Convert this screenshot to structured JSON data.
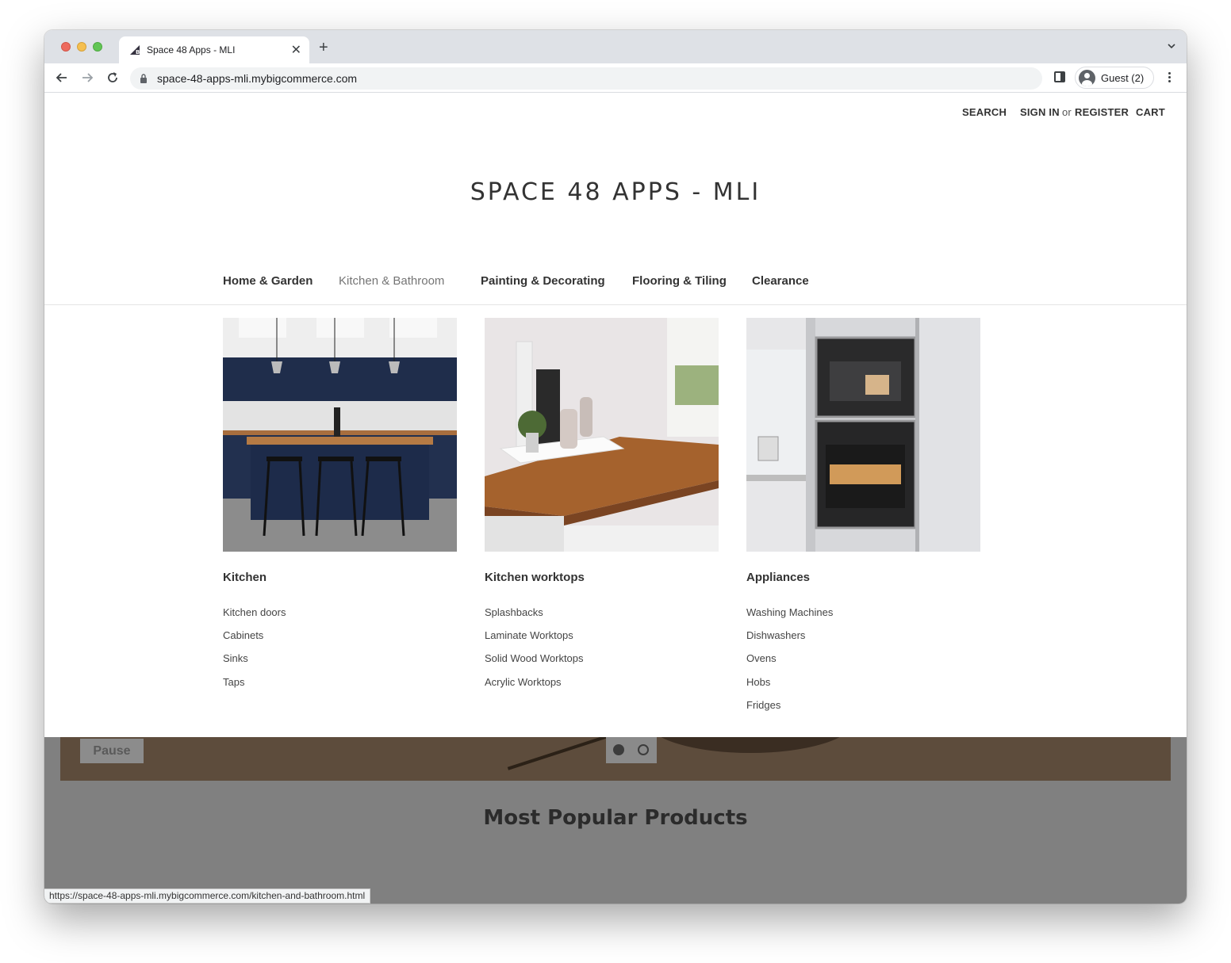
{
  "browser": {
    "tab_title": "Space 48 Apps - MLI",
    "new_tab": "+",
    "close_tab": "✕",
    "url": "space-48-apps-mli.mybigcommerce.com",
    "profile_label": "Guest (2)",
    "status_url": "https://space-48-apps-mli.mybigcommerce.com/kitchen-and-bathroom.html"
  },
  "header": {
    "search": "SEARCH",
    "sign_in": "SIGN IN",
    "or": "or",
    "register": "REGISTER",
    "cart": "CART",
    "store_title": "SPACE 48 APPS - MLI"
  },
  "nav": {
    "items": [
      {
        "label": "Home & Garden",
        "active": false
      },
      {
        "label": "Kitchen & Bathroom",
        "active": true
      },
      {
        "label": "Painting & Decorating",
        "active": false
      },
      {
        "label": "Flooring & Tiling",
        "active": false
      },
      {
        "label": "Clearance",
        "active": false
      }
    ]
  },
  "megamenu": {
    "columns": [
      {
        "heading": "Kitchen",
        "image": "kitchen-island-photo",
        "links": [
          "Kitchen doors",
          "Cabinets",
          "Sinks",
          "Taps"
        ]
      },
      {
        "heading": "Kitchen worktops",
        "image": "wood-worktop-photo",
        "links": [
          "Splashbacks",
          "Laminate Worktops",
          "Solid Wood Worktops",
          "Acrylic Worktops"
        ]
      },
      {
        "heading": "Appliances",
        "image": "built-in-ovens-photo",
        "links": [
          "Washing Machines",
          "Dishwashers",
          "Ovens",
          "Hobs",
          "Fridges"
        ]
      }
    ]
  },
  "carousel": {
    "pause_label": "Pause"
  },
  "section": {
    "popular_title": "Most Popular Products"
  },
  "colors": {
    "brand_text": "#333333",
    "overlay": "#808080",
    "hero_brown": "#5d4c3c"
  }
}
